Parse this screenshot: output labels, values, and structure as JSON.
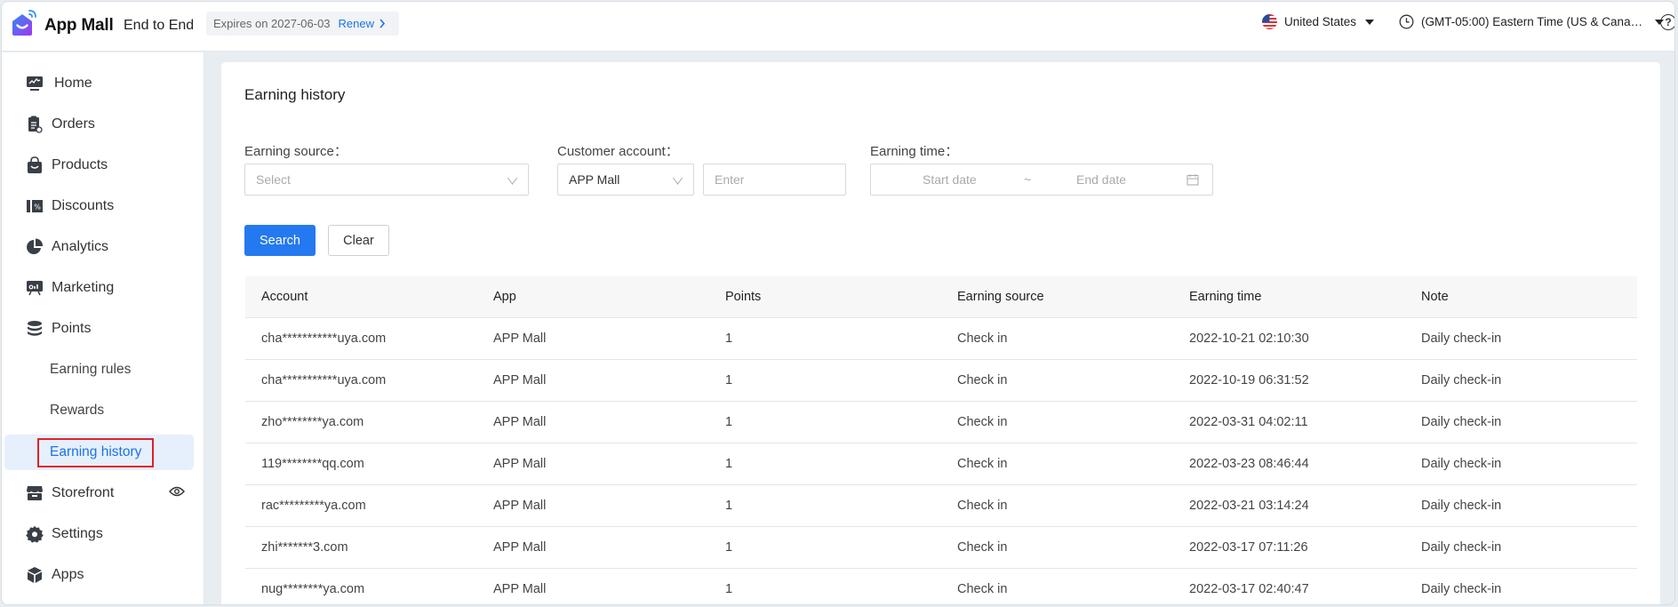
{
  "header": {
    "brand": "App Mall",
    "brand_subtitle": "End to End",
    "expires_text": "Expires on 2027-06-03",
    "renew_label": "Renew",
    "region": "United States",
    "timezone": "(GMT-05:00) Eastern Time (US & Cana…",
    "help_label": "?"
  },
  "sidebar": {
    "items": [
      {
        "label": "Home",
        "icon": "monitor-chart-icon"
      },
      {
        "label": "Orders",
        "icon": "clipboard-icon"
      },
      {
        "label": "Products",
        "icon": "shopping-bag-icon"
      },
      {
        "label": "Discounts",
        "icon": "coupon-icon"
      },
      {
        "label": "Analytics",
        "icon": "pie-chart-icon"
      },
      {
        "label": "Marketing",
        "icon": "billboard-icon"
      },
      {
        "label": "Points",
        "icon": "coins-stack-icon"
      },
      {
        "label": "Earning rules",
        "sub": true
      },
      {
        "label": "Rewards",
        "sub": true
      },
      {
        "label": "Earning history",
        "sub": true,
        "active": true
      },
      {
        "label": "Storefront",
        "icon": "store-icon",
        "extra_icon": "eye-icon"
      },
      {
        "label": "Settings",
        "icon": "gear-icon"
      },
      {
        "label": "Apps",
        "icon": "box-icon"
      }
    ]
  },
  "main": {
    "title": "Earning history",
    "filters": {
      "earning_source_label": "Earning source：",
      "earning_source_placeholder": "Select",
      "customer_account_label": "Customer account：",
      "customer_account_app": "APP Mall",
      "customer_account_placeholder": "Enter",
      "earning_time_label": "Earning time：",
      "start_date_placeholder": "Start date",
      "range_separator": "~",
      "end_date_placeholder": "End date"
    },
    "buttons": {
      "search": "Search",
      "clear": "Clear"
    },
    "table": {
      "columns": [
        "Account",
        "App",
        "Points",
        "Earning source",
        "Earning time",
        "Note"
      ],
      "rows": [
        [
          "cha***********uya.com",
          "APP Mall",
          "1",
          "Check in",
          "2022-10-21 02:10:30",
          "Daily check-in"
        ],
        [
          "cha***********uya.com",
          "APP Mall",
          "1",
          "Check in",
          "2022-10-19 06:31:52",
          "Daily check-in"
        ],
        [
          "zho********ya.com",
          "APP Mall",
          "1",
          "Check in",
          "2022-03-31 04:02:11",
          "Daily check-in"
        ],
        [
          "119********qq.com",
          "APP Mall",
          "1",
          "Check in",
          "2022-03-23 08:46:44",
          "Daily check-in"
        ],
        [
          "rac*********ya.com",
          "APP Mall",
          "1",
          "Check in",
          "2022-03-21 03:14:24",
          "Daily check-in"
        ],
        [
          "zhi*******3.com",
          "APP Mall",
          "1",
          "Check in",
          "2022-03-17 07:11:26",
          "Daily check-in"
        ],
        [
          "nug********ya.com",
          "APP Mall",
          "1",
          "Check in",
          "2022-03-17 02:40:47",
          "Daily check-in"
        ]
      ]
    }
  },
  "colors": {
    "accent": "#2479f0",
    "active_nav_bg": "#e6f0fc",
    "highlight_box": "#e0202a"
  }
}
